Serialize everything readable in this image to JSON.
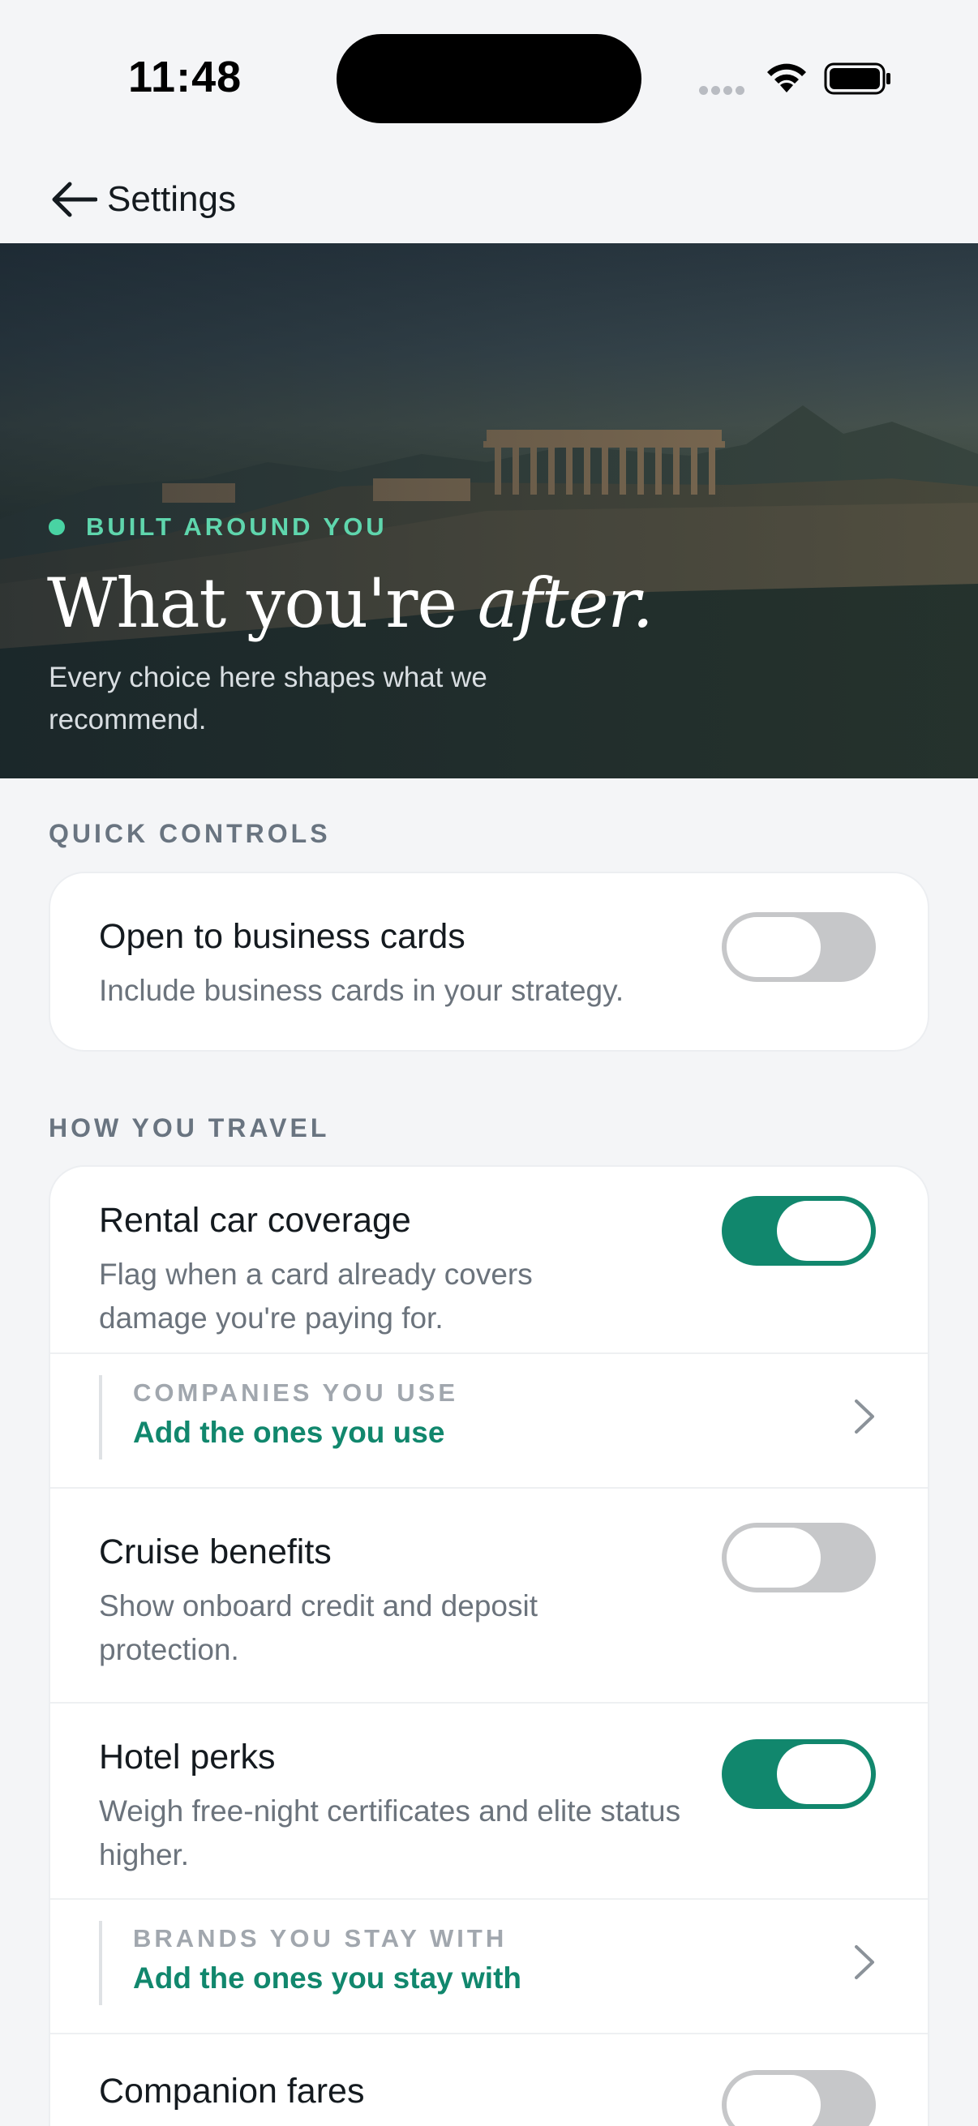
{
  "status_bar": {
    "time": "11:48"
  },
  "nav": {
    "back_label": "Settings"
  },
  "hero": {
    "eyebrow": "BUILT AROUND YOU",
    "title_main": "What you're ",
    "title_emphasis": "after.",
    "subtitle": "Every choice here shapes what we recommend."
  },
  "quick_controls": {
    "label": "QUICK CONTROLS",
    "items": [
      {
        "title": "Open to business cards",
        "description": "Include business cards in your strategy.",
        "enabled": false
      }
    ]
  },
  "how_you_travel": {
    "label": "HOW YOU TRAVEL",
    "items": [
      {
        "title": "Rental car coverage",
        "description": "Flag when a card already covers damage you're paying for.",
        "enabled": true,
        "sub": {
          "label": "COMPANIES YOU USE",
          "value": "Add the ones you use"
        }
      },
      {
        "title": "Cruise benefits",
        "description": "Show onboard credit and deposit protection.",
        "enabled": false
      },
      {
        "title": "Hotel perks",
        "description": "Weigh free-night certificates and elite status higher.",
        "enabled": true,
        "sub": {
          "label": "BRANDS YOU STAY WITH",
          "value": "Add the ones you stay with"
        }
      },
      {
        "title": "Companion fares",
        "enabled": false
      }
    ]
  },
  "colors": {
    "accent": "#11876d",
    "accent_light": "#5fd6ad",
    "toggle_off": "#c6c7c9",
    "background": "#f4f5f7"
  },
  "icons": {
    "back": "arrow-left-icon",
    "chevron": "chevron-right-icon",
    "wifi": "wifi-icon",
    "battery": "battery-icon",
    "signal": "cellular-signal-icon"
  }
}
